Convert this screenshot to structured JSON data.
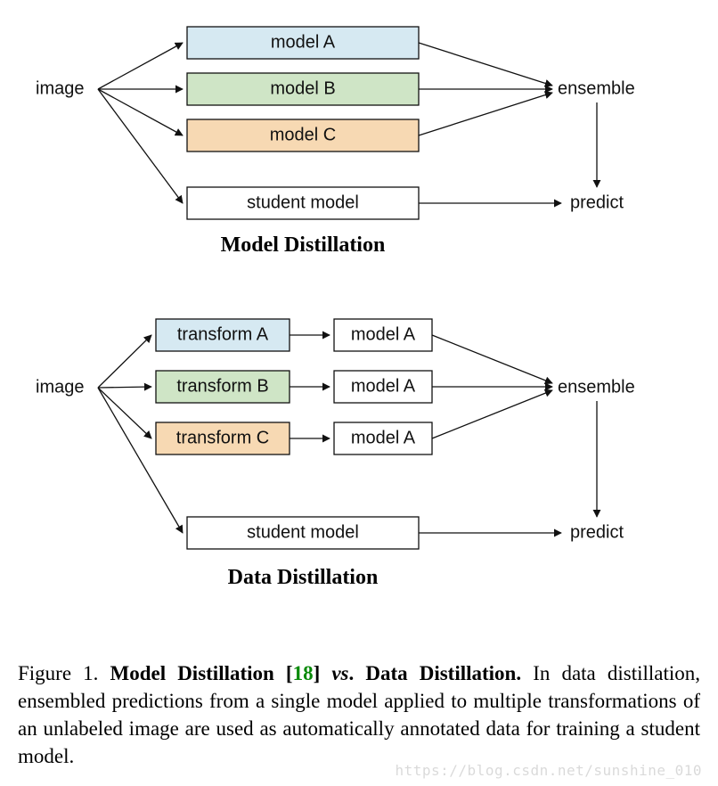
{
  "diagram1": {
    "input_label": "image",
    "box_a": "model A",
    "box_b": "model B",
    "box_c": "model C",
    "student": "student model",
    "ensemble": "ensemble",
    "predict": "predict",
    "title": "Model Distillation"
  },
  "diagram2": {
    "input_label": "image",
    "transform_a": "transform A",
    "transform_b": "transform B",
    "transform_c": "transform C",
    "model_a1": "model A",
    "model_a2": "model A",
    "model_a3": "model A",
    "student": "student model",
    "ensemble": "ensemble",
    "predict": "predict",
    "title": "Data Distillation"
  },
  "caption": {
    "prefix": "Figure 1. ",
    "bold1": "Model Distillation [",
    "ref": "18",
    "bold2": "] ",
    "vs": "vs",
    "bold3": ". Data Distillation.",
    "rest": " In data distillation, ensembled predictions from a single model applied to multiple transformations of an unlabeled image are used as automatically annotated data for training a student model."
  },
  "colors": {
    "blue": "#d6e9f2",
    "green": "#cfe5c6",
    "orange": "#f7d9b3",
    "white": "#ffffff"
  },
  "watermark": "https://blog.csdn.net/sunshine_010"
}
